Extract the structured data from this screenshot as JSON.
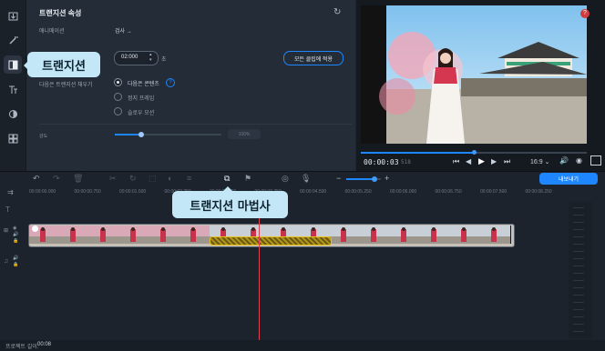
{
  "panel": {
    "title": "트랜지션 속성",
    "animation_label": "애니메이션",
    "animation_value": "검사 →",
    "duration_value": "02:000",
    "duration_unit": "초",
    "apply_all_label": "모든 클립에 적용",
    "fill_label": "다음은 트랜지션 채우기",
    "option_next": "다음은 콘텐츠",
    "option_freeze": "정지 프레임",
    "option_slow": "슬로우 모션",
    "strength_label": "강도",
    "strength_value": "100%",
    "strength_level": 0.25
  },
  "callouts": {
    "transitions": "트랜지션",
    "wizard": "트랜지션 마법사"
  },
  "player": {
    "time_current": "00:00:03",
    "time_frac": "518",
    "aspect": "16:9 ⌄",
    "progress": 0.5,
    "export_label": "내보내기"
  },
  "timeline": {
    "ticks": [
      "00:00:00.000",
      "00:00:00.750",
      "00:00:01.500",
      "00:00:02.250",
      "00:00:03.000",
      "00:00:03.750",
      "00:00:04.500",
      "00:00:05.250",
      "00:00:06.000",
      "00:00:06.750",
      "00:00:07.500",
      "00:00:08.250"
    ]
  },
  "status": {
    "label": "프로젝트 길이:",
    "length": "00:08"
  },
  "colors": {
    "accent": "#1e86ff",
    "callout": "#c4e7f7",
    "playhead": "#e0404f",
    "transition": "#e8c11a"
  },
  "icons": [
    "import-icon",
    "magic-wand-icon",
    "transitions-icon",
    "titles-icon",
    "filters-icon",
    "more-icon"
  ]
}
